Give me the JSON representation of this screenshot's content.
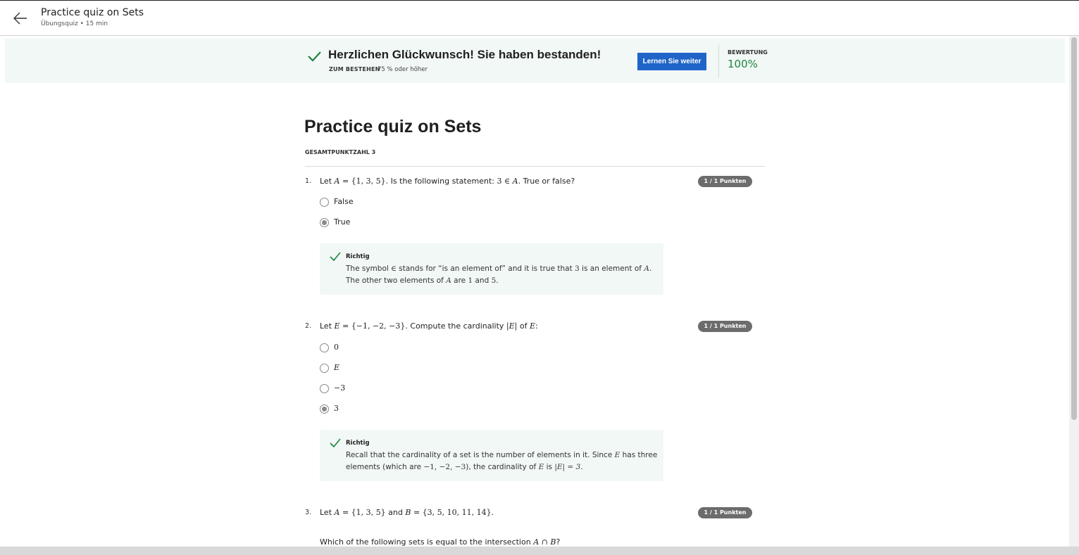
{
  "header": {
    "title": "Practice quiz on Sets",
    "subtitle": "Übungsquiz • 15 min"
  },
  "banner": {
    "title": "Herzlichen Glückwunsch! Sie haben bestanden!",
    "pass_label": "ZUM BESTEHEN",
    "pass_value": "75 % oder höher",
    "continue_label": "Lernen Sie weiter",
    "grade_label": "BEWERTUNG",
    "grade_value": "100%"
  },
  "quiz": {
    "title": "Practice quiz on Sets",
    "total_points": "GESAMTPUNKTZAHL 3"
  },
  "questions": [
    {
      "number": "1.",
      "points": "1 / 1 Punkten",
      "text": {
        "p1": "Let ",
        "m1": "A",
        "m2": " = {1, 3, 5}",
        "p2": ". Is the following statement: ",
        "m3": "3 ∈ ",
        "m4": "A",
        "p3": ". True or false?"
      },
      "options": [
        {
          "label": "False",
          "selected": false
        },
        {
          "label": "True",
          "selected": true
        }
      ],
      "feedback": {
        "label": "Richtig",
        "line1": {
          "a": "The symbol ",
          "b": "∈",
          "c": " stands for “is an element of” and it is true that ",
          "d": "3",
          "e": " is an element of ",
          "f": "A",
          "g": "."
        },
        "line2": {
          "a": "The other two elements of ",
          "b": "A",
          "c": " are ",
          "d": "1",
          "e": " and ",
          "f": "5",
          "g": "."
        }
      }
    },
    {
      "number": "2.",
      "points": "1 / 1 Punkten",
      "text": {
        "p1": "Let ",
        "m1": "E",
        "m2": " = {−1, −2, −3}",
        "p2": ". Compute the cardinality ",
        "m3": "|E|",
        "p3": " of ",
        "m4": "E",
        "p4": ":"
      },
      "options": [
        {
          "label": "0",
          "selected": false
        },
        {
          "label": "E",
          "selected": false
        },
        {
          "label": "−3",
          "selected": false
        },
        {
          "label": "3",
          "selected": true
        }
      ],
      "feedback": {
        "label": "Richtig",
        "line1": {
          "a": "Recall that the cardinality of a set is the number of elements in it. Since ",
          "b": "E",
          "c": " has three"
        },
        "line2": {
          "a": "elements (which are ",
          "b": "−1, −2, −3",
          "c": "), the cardinality of ",
          "d": "E",
          "e": " is ",
          "f": "|E| = 3",
          "g": "."
        }
      }
    },
    {
      "number": "3.",
      "points": "1 / 1 Punkten",
      "text": {
        "p1": "Let ",
        "m1": "A",
        "m2": " = {1, 3, 5}",
        "p2": " and ",
        "m3": "B",
        "m4": " = {3, 5, 10, 11, 14}",
        "p3": "."
      },
      "subtext": {
        "a": "Which of the following sets is equal to the intersection ",
        "b": "A ∩ B",
        "c": "?"
      }
    }
  ],
  "colors": {
    "accent": "#1f65c9",
    "success": "#1e8540",
    "banner_bg": "#f1f8f6",
    "badge": "#6c6c6c"
  },
  "icons": {
    "back": "arrow-left-icon",
    "check": "check-icon"
  }
}
